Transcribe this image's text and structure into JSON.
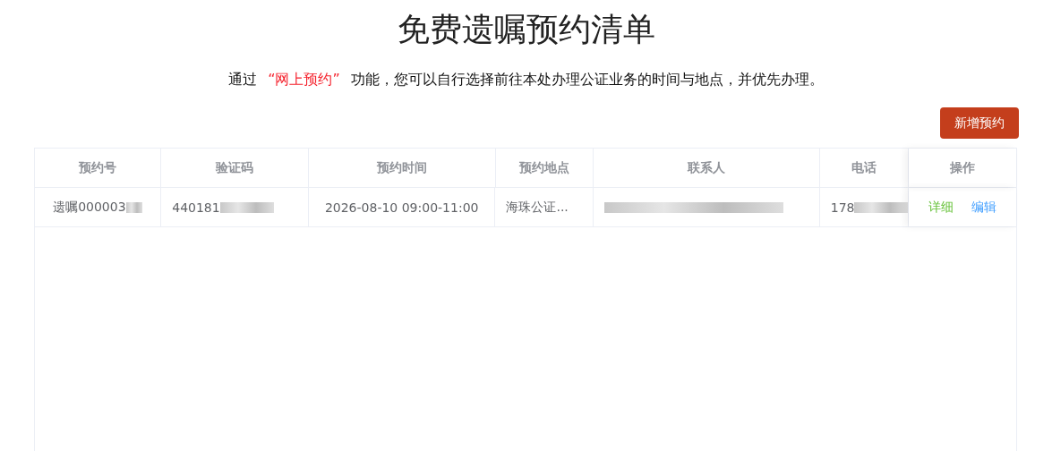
{
  "title": "免费遗嘱预约清单",
  "intro": {
    "prefix": "通过",
    "highlight": "“网上预约”",
    "suffix": "功能，您可以自行选择前往本处办理公证业务的时间与地点，并优先办理。"
  },
  "add_button": "新增预约",
  "table": {
    "columns": [
      "预约号",
      "验证码",
      "预约时间",
      "预约地点",
      "联系人",
      "电话",
      "操作"
    ],
    "rows": [
      {
        "cells": [
          {
            "text": "遗嘱000003",
            "redacted": true
          },
          {
            "text": "440181",
            "redacted": true
          },
          {
            "text": "2026-08-10 09:00-11:00",
            "redacted": false
          },
          {
            "text": "海珠公证...",
            "redacted": false
          },
          {
            "text": "",
            "redacted": true
          },
          {
            "text": "178",
            "redacted": true
          }
        ],
        "actions": [
          {
            "kind": "detail",
            "label": "详细"
          },
          {
            "kind": "edit",
            "label": "编辑"
          }
        ]
      }
    ]
  }
}
